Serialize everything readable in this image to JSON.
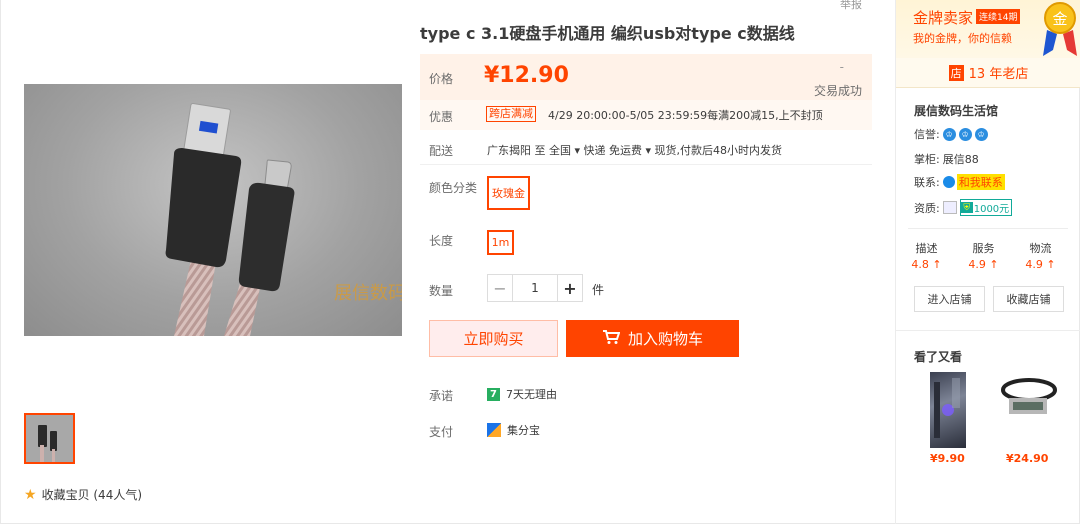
{
  "header": {
    "report": "举报"
  },
  "gallery": {
    "favorite": "收藏宝贝 (44人气)"
  },
  "product": {
    "title": "type c 3.1硬盘手机通用 编织usb对type c数据线",
    "price_label": "价格",
    "price": "¥12.90",
    "sales_dash": "-",
    "sales_label": "交易成功",
    "promo_label": "优惠",
    "promo_tag": "跨店满减",
    "promo_text": "4/29 20:00:00-5/05 23:59:59每满200减15,上不封顶",
    "ship_label": "配送",
    "ship_text": "广东揭阳 至  全国 ▾   快递 免运费 ▾   现货,付款后48小时内发货",
    "color_label": "颜色分类",
    "color_option": "玫瑰金",
    "length_label": "长度",
    "length_option": "1m",
    "qty_label": "数量",
    "qty_minus": "−",
    "qty_value": "1",
    "qty_plus": "+",
    "qty_unit": "件",
    "buy_now": "立即购买",
    "add_cart": "加入购物车",
    "promise_label": "承诺",
    "promise_text": "7天无理由",
    "promise_icon_text": "7",
    "pay_label": "支付",
    "pay_text": "集分宝"
  },
  "shop": {
    "gold_title": "金牌卖家",
    "streak": "连续14期",
    "gold_sub": "我的金牌，你的信赖",
    "medal_char": "金",
    "old_store_icon": "店",
    "old_store": "13 年老店",
    "name": "展信数码生活馆",
    "credit_label": "信誉:",
    "keeper_label": "掌柜:",
    "keeper": "展信88",
    "contact_label": "联系:",
    "contact": "和我联系",
    "qual_label": "资质:",
    "deposit": "1000元",
    "scores": [
      {
        "label": "描述",
        "value": "4.8 ↑"
      },
      {
        "label": "服务",
        "value": "4.9 ↑"
      },
      {
        "label": "物流",
        "value": "4.9 ↑"
      }
    ],
    "enter_shop": "进入店铺",
    "fav_shop": "收藏店铺",
    "seen_title": "看了又看",
    "seen": [
      {
        "price": "¥9.90"
      },
      {
        "price": "¥24.90"
      }
    ]
  },
  "colors": {
    "accent": "#ff4400",
    "gold": "#f5a623"
  }
}
